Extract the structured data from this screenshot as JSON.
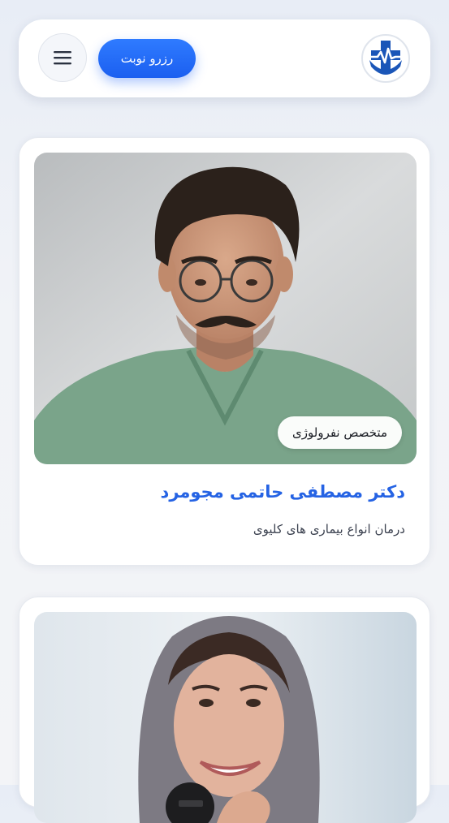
{
  "header": {
    "book_label": "رزرو نوبت",
    "menu_icon": "hamburger-menu-icon",
    "logo_icon": "medical-cross-heartbeat-logo"
  },
  "doctors": [
    {
      "name": "دکتر مصطفی حاتمی مجومرد",
      "specialty": "متخصص نفرولوژی",
      "description": "درمان انواع بیماری های کلیوی"
    }
  ],
  "colors": {
    "accent": "#2563e4",
    "button": "#1f66f5",
    "logo_blue": "#1b56b8"
  }
}
